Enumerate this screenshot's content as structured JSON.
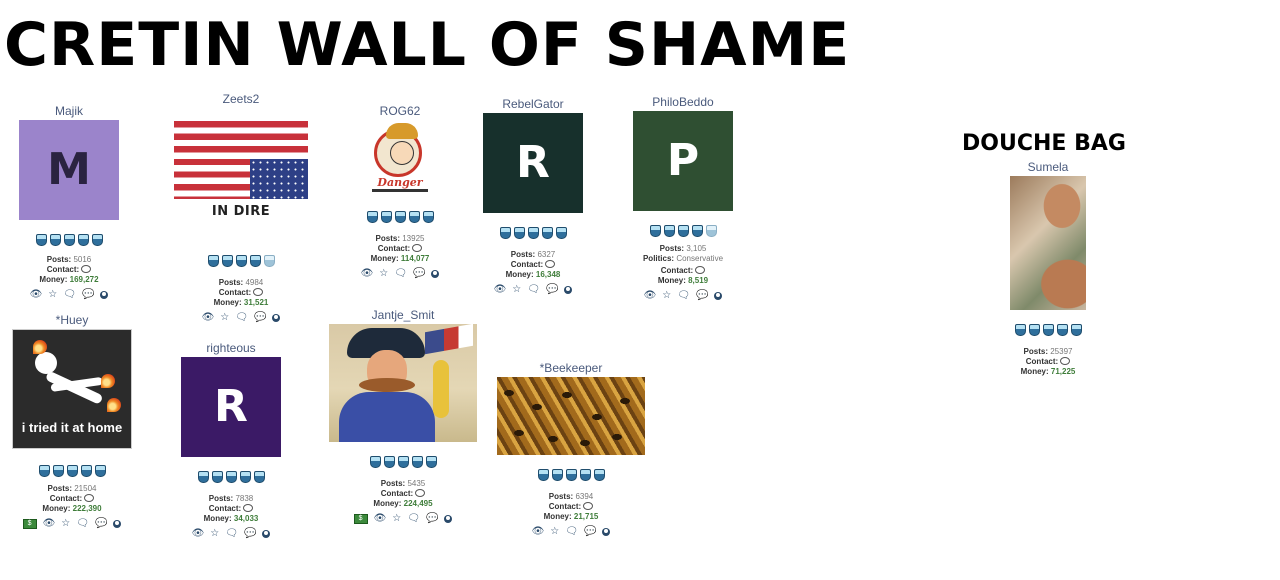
{
  "page": {
    "title": "CRETIN WALL OF SHAME",
    "douche_title": "DOUCHE BAG"
  },
  "icons": [
    "eye-icon",
    "star-icon",
    "comment-icon",
    "comments-icon",
    "user-circle-icon",
    "money-icon",
    "shield-badge-icon",
    "speech-bubble-icon"
  ],
  "colors": {
    "username": "#4a5a7c",
    "money": "#3f7d3a",
    "badge_dark": "#2f6f9c",
    "badge_light": "#b5e1f3"
  },
  "labels": {
    "posts": "Posts:",
    "contact": "Contact:",
    "money": "Money:",
    "politics": "Politics:"
  },
  "cards": [
    {
      "username": "Majik",
      "avatar_letter": "M",
      "avatar_bg": "#9b84cb",
      "posts": "5016",
      "money": "169,272",
      "badges_full": 5,
      "badges_faded": 0
    },
    {
      "username": "Zeets2",
      "avatar_caption": "IN DIRE DISTRESS",
      "posts": "4984",
      "money": "31,521",
      "badges_full": 4,
      "badges_faded": 1
    },
    {
      "username": "ROG62",
      "avatar_text": "Danger",
      "posts": "13925",
      "money": "114,077",
      "badges_full": 5,
      "badges_faded": 0
    },
    {
      "username": "RebelGator",
      "avatar_letter": "R",
      "avatar_bg": "#17302c",
      "posts": "6327",
      "money": "16,348",
      "badges_full": 5,
      "badges_faded": 0
    },
    {
      "username": "PhiloBeddo",
      "avatar_letter": "P",
      "avatar_bg": "#2f4f32",
      "posts": "3,105",
      "politics": "Conservative",
      "money": "8,519",
      "badges_full": 4,
      "badges_faded": 1
    },
    {
      "username": "*Huey",
      "avatar_caption": "i tried it at home",
      "posts": "21504",
      "money": "222,390",
      "badges_full": 5,
      "badges_faded": 0
    },
    {
      "username": "righteous",
      "avatar_letter": "R",
      "avatar_bg": "#3b1a66",
      "posts": "7838",
      "money": "34,033",
      "badges_full": 5,
      "badges_faded": 0
    },
    {
      "username": "Jantje_Smit",
      "posts": "5435",
      "money": "224,495",
      "badges_full": 5,
      "badges_faded": 0
    },
    {
      "username": "*Beekeeper",
      "posts": "6394",
      "money": "21,715",
      "badges_full": 5,
      "badges_faded": 0
    },
    {
      "username": "Sumela",
      "posts": "25397",
      "money": "71,225",
      "badges_full": 5,
      "badges_faded": 0
    }
  ]
}
